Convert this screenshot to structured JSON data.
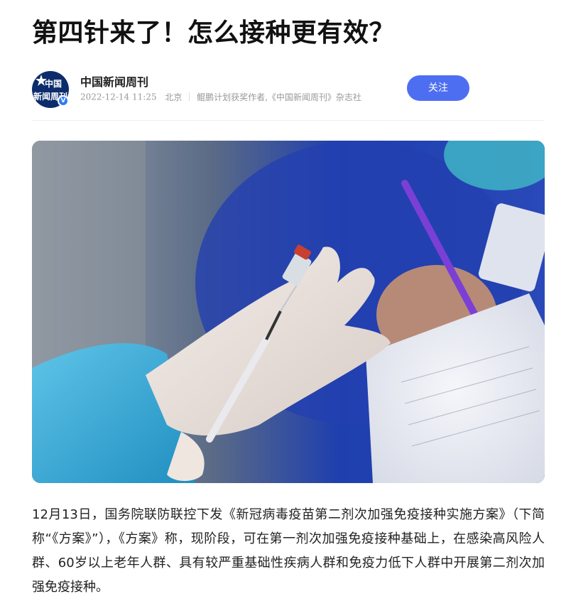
{
  "article": {
    "title": "第四针来了！怎么接种更有效？",
    "paragraph_1": "12月13日，国务院联防联控下发《新冠病毒疫苗第二剂次加强免疫接种实施方案》（下简称“《方案》”），《方案》称，现阶段，可在第一剂次加强免疫接种基础上，在感染高风险人群、60岁以上老年人群、具有较严重基础性疾病人群和免疫力低下人群中开展第二剂次加强免疫接种。"
  },
  "author": {
    "name": "中国新闻周刊",
    "avatar_text_top": "中国",
    "avatar_text_bottom": "新闻周刊",
    "verified_mark": "V",
    "date": "2022-12-14 11:25",
    "location": "北京",
    "description": "鲲鹏计划获奖作者,《中国新闻周刊》杂志社",
    "follow_label": "关注"
  },
  "colors": {
    "accent": "#4e6ef2",
    "verified": "#2f7bf5",
    "meta_text": "#999999"
  },
  "image": {
    "description": "vaccine-syringe-photo"
  }
}
